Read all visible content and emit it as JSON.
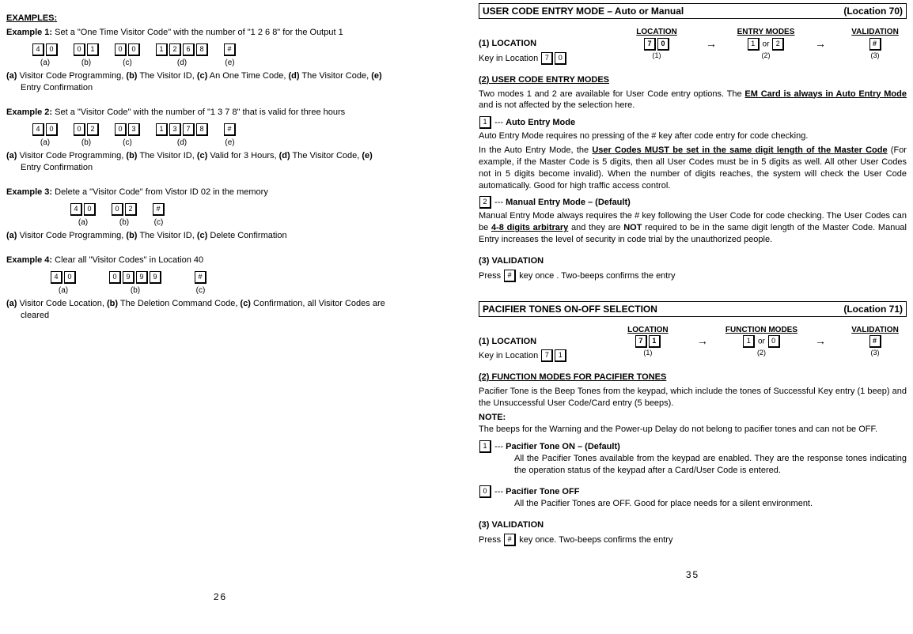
{
  "left": {
    "examples_heading": "EXAMPLES:",
    "ex1": {
      "title": "Example 1:",
      "desc": "Set a \"One Time Visitor Code\" with the number of \"1 2 6 8\" for the Output 1",
      "groups": [
        {
          "keys": [
            "4",
            "0"
          ],
          "label": "(a)"
        },
        {
          "keys": [
            "0",
            "1"
          ],
          "label": "(b)"
        },
        {
          "keys": [
            "0",
            "0"
          ],
          "label": "(c)"
        },
        {
          "keys": [
            "1",
            "2",
            "6",
            "8"
          ],
          "label": "(d)"
        },
        {
          "keys": [
            "#"
          ],
          "label": "(e)"
        }
      ],
      "legend": "(a) Visitor Code Programming, (b) The Visitor ID, (c) An One Time Code, (d) The Visitor Code, (e) Entry Confirmation"
    },
    "ex2": {
      "title": "Example 2:",
      "desc": "Set a \"Visitor Code\" with the number of \"1 3 7 8\" that is valid for three hours",
      "groups": [
        {
          "keys": [
            "4",
            "0"
          ],
          "label": "(a)"
        },
        {
          "keys": [
            "0",
            "2"
          ],
          "label": "(b)"
        },
        {
          "keys": [
            "0",
            "3"
          ],
          "label": "(c)"
        },
        {
          "keys": [
            "1",
            "3",
            "7",
            "8"
          ],
          "label": "(d)"
        },
        {
          "keys": [
            "#"
          ],
          "label": "(e)"
        }
      ],
      "legend": "(a) Visitor Code Programming, (b) The Visitor ID, (c) Valid for 3 Hours, (d) The Visitor Code, (e) Entry Confirmation"
    },
    "ex3": {
      "title": "Example 3:",
      "desc": "Delete a \"Visitor Code\" from Vistor ID 02 in the memory",
      "groups": [
        {
          "keys": [
            "4",
            "0"
          ],
          "label": "(a)"
        },
        {
          "keys": [
            "0",
            "2"
          ],
          "label": "(b)"
        },
        {
          "keys": [
            "#"
          ],
          "label": "(c)"
        }
      ],
      "legend": "(a) Visitor Code Programming, (b) The Visitor ID, (c) Delete Confirmation"
    },
    "ex4": {
      "title": "Example 4:",
      "desc": "Clear all \"Visitor Codes\" in Location 40",
      "groups": [
        {
          "keys": [
            "4",
            "0"
          ],
          "label": "(a)"
        },
        {
          "keys": [
            "0",
            "9",
            "9",
            "9"
          ],
          "label": "(b)"
        },
        {
          "keys": [
            "#"
          ],
          "label": "(c)"
        }
      ],
      "legend": "(a) Visitor Code Location, (b) The Deletion Command Code, (c) Confirmation, all Visitor Codes are cleared"
    },
    "pageno": "26"
  },
  "right": {
    "sec1": {
      "title": "USER CODE ENTRY MODE – Auto or Manual",
      "loc": "(Location 70)",
      "head_location": "LOCATION",
      "head_entry": "ENTRY MODES",
      "head_validation": "VALIDATION",
      "row_loc_keys": [
        "7",
        "0"
      ],
      "row_loc_sub": "(1)",
      "row_entry_keys_a": "1",
      "row_entry_or": "or",
      "row_entry_keys_b": "2",
      "row_entry_sub": "(2)",
      "row_val_key": "#",
      "row_val_sub": "(3)",
      "loc_heading": "(1) LOCATION",
      "loc_text_pre": "Key in Location",
      "loc_text_keys": [
        "7",
        "0"
      ],
      "modes_heading": "(2) USER CODE ENTRY MODES",
      "modes_intro_a": "Two modes 1 and 2 are available for User Code entry options. The ",
      "modes_intro_b": "EM Card is always in Auto Entry Mode",
      "modes_intro_c": " and is not affected by the selection here.",
      "mode1_key": "1",
      "mode1_dash": " --- ",
      "mode1_title": "Auto Entry Mode",
      "mode1_p1": "Auto Entry Mode requires no pressing of the # key after code entry for code checking.",
      "mode1_p2a": "In the Auto Entry Mode, the ",
      "mode1_p2b": "User Codes MUST be set in the same digit length of the Master Code",
      "mode1_p2c": " (For example, if the Master Code is 5 digits, then all User Codes must be in 5 digits as well. All other User Codes not in 5 digits become invalid). When the number of digits reaches, the system will check the User Code automatically. Good for high traffic access control.",
      "mode2_key": "2",
      "mode2_dash": " --- ",
      "mode2_title": "Manual Entry Mode – (Default)",
      "mode2_p_a": "Manual Entry Mode always requires the # key following the User Code for code checking. The User Codes can be ",
      "mode2_p_b": "4-8 digits arbitrary",
      "mode2_p_c": " and they are ",
      "mode2_p_d": "NOT",
      "mode2_p_e": " required to be in the same digit length of the Master Code. Manual Entry increases the level of security in code trial by the unauthorized people.",
      "val_heading": "(3) VALIDATION",
      "val_text_a": "Press ",
      "val_key": "#",
      "val_text_b": " key once . Two-beeps confirms the entry"
    },
    "sec2": {
      "title": "PACIFIER TONES ON-OFF SELECTION",
      "loc": "(Location 71)",
      "head_location": "LOCATION",
      "head_function": "FUNCTION MODES",
      "head_validation": "VALIDATION",
      "row_loc_keys": [
        "7",
        "1"
      ],
      "row_loc_sub": "(1)",
      "row_fn_a": "1",
      "row_fn_or": "or",
      "row_fn_b": "0",
      "row_fn_sub": "(2)",
      "row_val_key": "#",
      "row_val_sub": "(3)",
      "loc_heading": "(1) LOCATION",
      "loc_text_pre": "Key in Location",
      "loc_text_keys": [
        "7",
        "1"
      ],
      "fn_heading": "(2) FUNCTION MODES FOR PACIFIER TONES",
      "fn_intro": "Pacifier Tone is the Beep Tones from the keypad, which include the tones of Successful Key entry (1 beep) and the Unsuccessful User Code/Card entry (5 beeps).",
      "note_label": "NOTE:",
      "note_text": "The beeps for the Warning and the Power-up Delay do not belong to pacifier tones and can not be OFF.",
      "opt1_key": "1",
      "opt1_dash": " --- ",
      "opt1_title": "Pacifier Tone ON – (Default)",
      "opt1_body": "All the Pacifier Tones available from the keypad are enabled. They are the response tones indicating the operation status of the keypad after a Card/User Code is entered.",
      "opt2_key": "0",
      "opt2_dash": " --- ",
      "opt2_title": "Pacifier Tone OFF",
      "opt2_body": "All the Pacifier Tones are OFF. Good for place needs for a silent environment.",
      "val_heading": "(3) VALIDATION",
      "val_text_a": "Press ",
      "val_key": "#",
      "val_text_b": " key once. Two-beeps confirms the entry"
    },
    "pageno": "35"
  }
}
